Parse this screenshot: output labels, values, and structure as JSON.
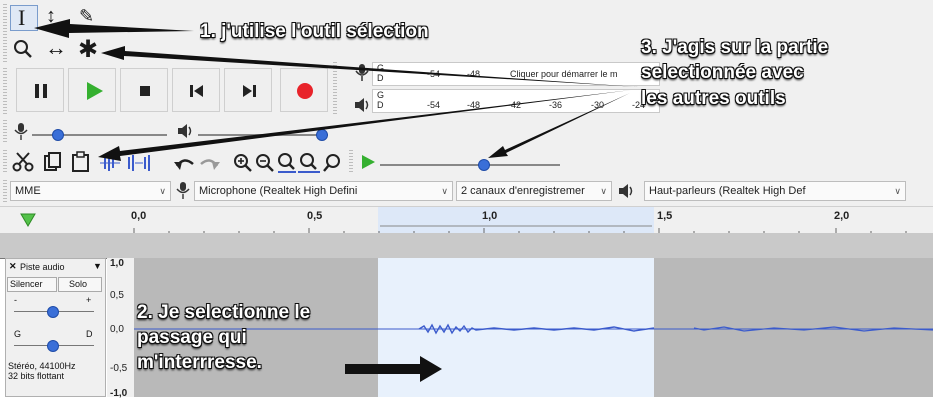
{
  "tools": {
    "selection_glyph": "I",
    "envelope_glyph": "↕",
    "draw_glyph": "✎",
    "zoom_glyph": "🔍",
    "timeshift_glyph": "↔",
    "multi_glyph": "✱"
  },
  "meters": {
    "record_channels": [
      "G",
      "D"
    ],
    "playback_channels": [
      "G",
      "D"
    ],
    "record_ticks": [
      "-54",
      "-48"
    ],
    "record_prompt": "Cliquer pour démarrer le m",
    "playback_ticks": [
      "-54",
      "-48",
      "-42",
      "-36",
      "-30",
      "-24"
    ]
  },
  "devices": {
    "host": "MME",
    "input": "Microphone (Realtek High Defini",
    "channels": "2 canaux d'enregistremer",
    "output": "Haut-parleurs (Realtek High Def"
  },
  "ruler": {
    "labels": [
      "0,0",
      "0,5",
      "1,0",
      "1,5",
      "2,0"
    ]
  },
  "track": {
    "name": "Piste audio",
    "mute": "Silencer",
    "solo": "Solo",
    "gain_minus": "-",
    "gain_plus": "+",
    "pan_left": "G",
    "pan_right": "D",
    "info_line1": "Stéréo, 44100Hz",
    "info_line2": "32 bits flottant",
    "scale": [
      "1,0",
      "0,5",
      "0,0",
      "-0,5",
      "-1,0"
    ]
  },
  "annotations": {
    "a1": "1. j'utilise l'outil sélection",
    "a2_line1": "2. Je selectionne le",
    "a2_line2": "passage qui",
    "a2_line3": "m'interrresse.",
    "a3_line1": "3. J'agis sur la partie",
    "a3_line2": "selectionnée avec",
    "a3_line3": "les autres outils"
  },
  "colors": {
    "record": "#e8232a",
    "play": "#35b030",
    "selection": "#e8f1fc",
    "waveform": "#3b5bcc",
    "slider_knob": "#3a6fd8"
  }
}
